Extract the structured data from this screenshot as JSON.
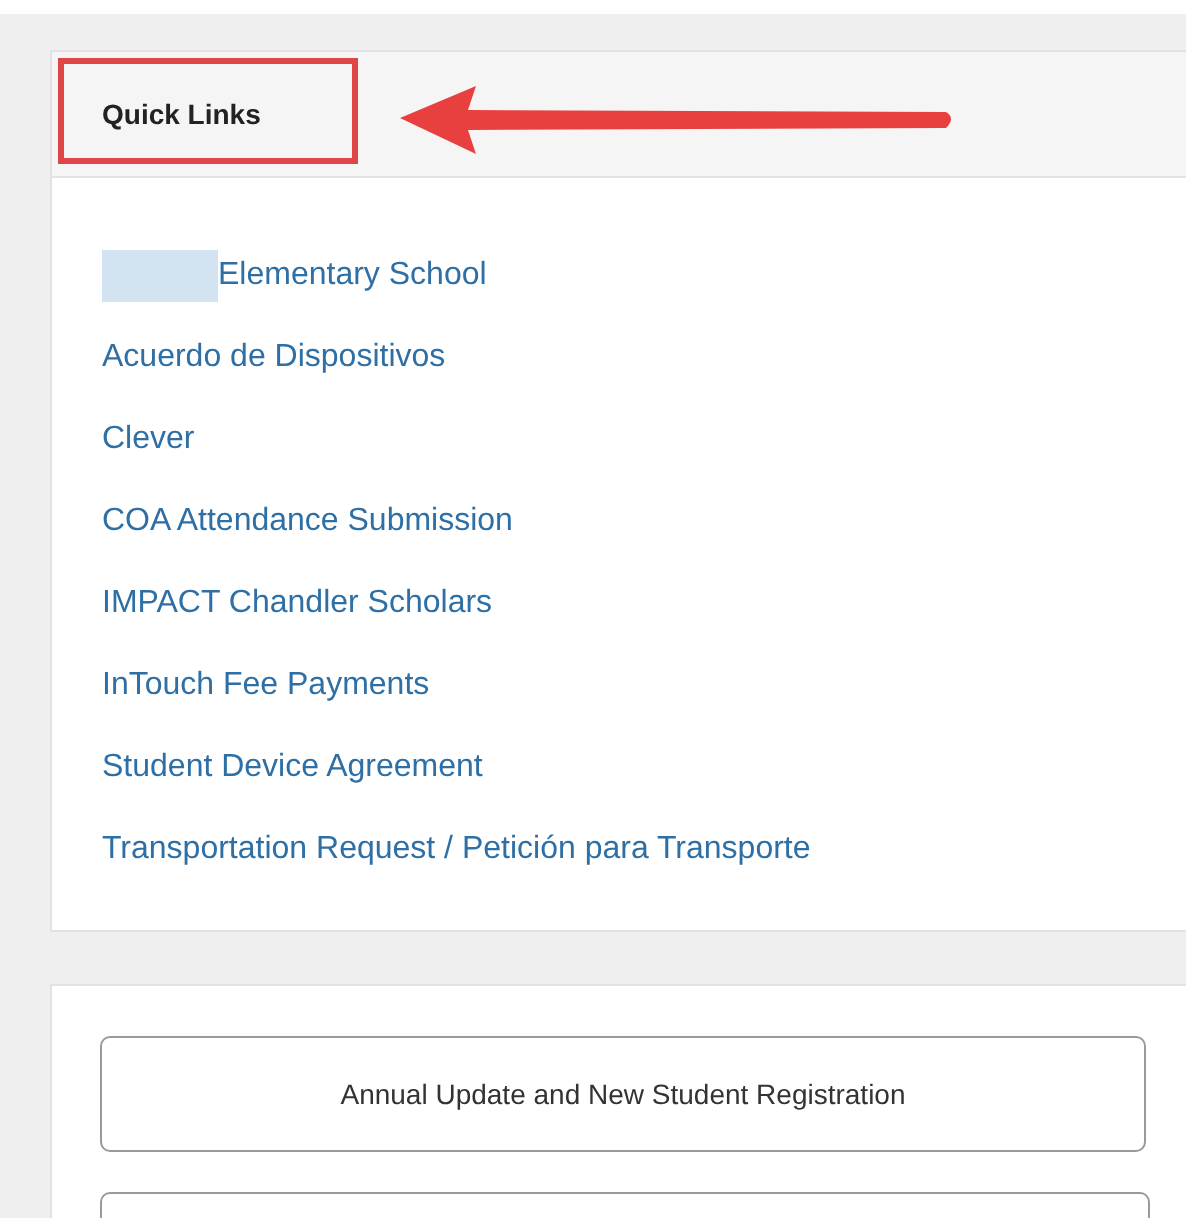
{
  "quick_links": {
    "title": "Quick Links",
    "highlighted": true,
    "links": [
      {
        "label": "Elementary School",
        "redacted_prefix": true
      },
      {
        "label": "Acuerdo de Dispositivos",
        "redacted_prefix": false
      },
      {
        "label": "Clever",
        "redacted_prefix": false
      },
      {
        "label": "COA Attendance Submission",
        "redacted_prefix": false
      },
      {
        "label": "IMPACT Chandler Scholars",
        "redacted_prefix": false
      },
      {
        "label": "InTouch Fee Payments",
        "redacted_prefix": false
      },
      {
        "label": "Student Device Agreement",
        "redacted_prefix": false
      },
      {
        "label": "Transportation Request / Petición para Transporte",
        "redacted_prefix": false
      }
    ]
  },
  "buttons": [
    "Annual Update and New Student Registration"
  ]
}
